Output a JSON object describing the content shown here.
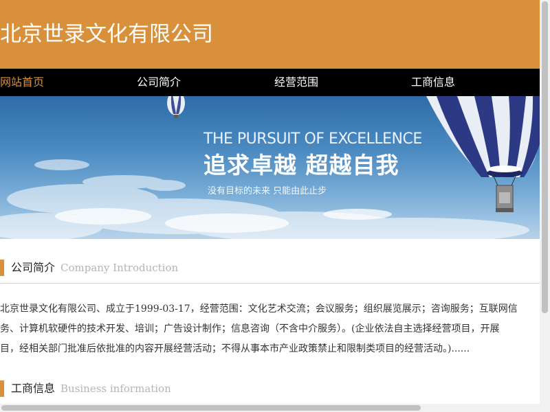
{
  "header": {
    "title": "北京世录文化有限公司"
  },
  "nav": {
    "items": [
      {
        "label": "网站首页",
        "active": true
      },
      {
        "label": "公司简介",
        "active": false
      },
      {
        "label": "经营范围",
        "active": false
      },
      {
        "label": "工商信息",
        "active": false
      }
    ]
  },
  "banner": {
    "english": "THE PURSUIT OF EXCELLENCE",
    "chinese": "追求卓越  超越自我",
    "subtitle": "没有目标的未来  只能由此止步"
  },
  "intro": {
    "title": "公司简介",
    "subtitle": "Company Introduction",
    "lines": [
      "北京世录文化有限公司、成立于1999-03-17，经营范围：文化艺术交流；会议服务；组织展览展示；咨询服务；互联网信",
      "务、计算机软硬件的技术开发、培训；广告设计制作；信息咨询（不含中介服务）。(企业依法自主选择经营项目，开展",
      "目，经相关部门批准后依批准的内容开展经营活动；不得从事本市产业政策禁止和限制类项目的经营活动。)......"
    ]
  },
  "business": {
    "title": "工商信息",
    "subtitle": "Business information"
  },
  "colors": {
    "brand": "#d9903b",
    "nav_bg": "#000000",
    "active_nav": "#d9903b"
  }
}
